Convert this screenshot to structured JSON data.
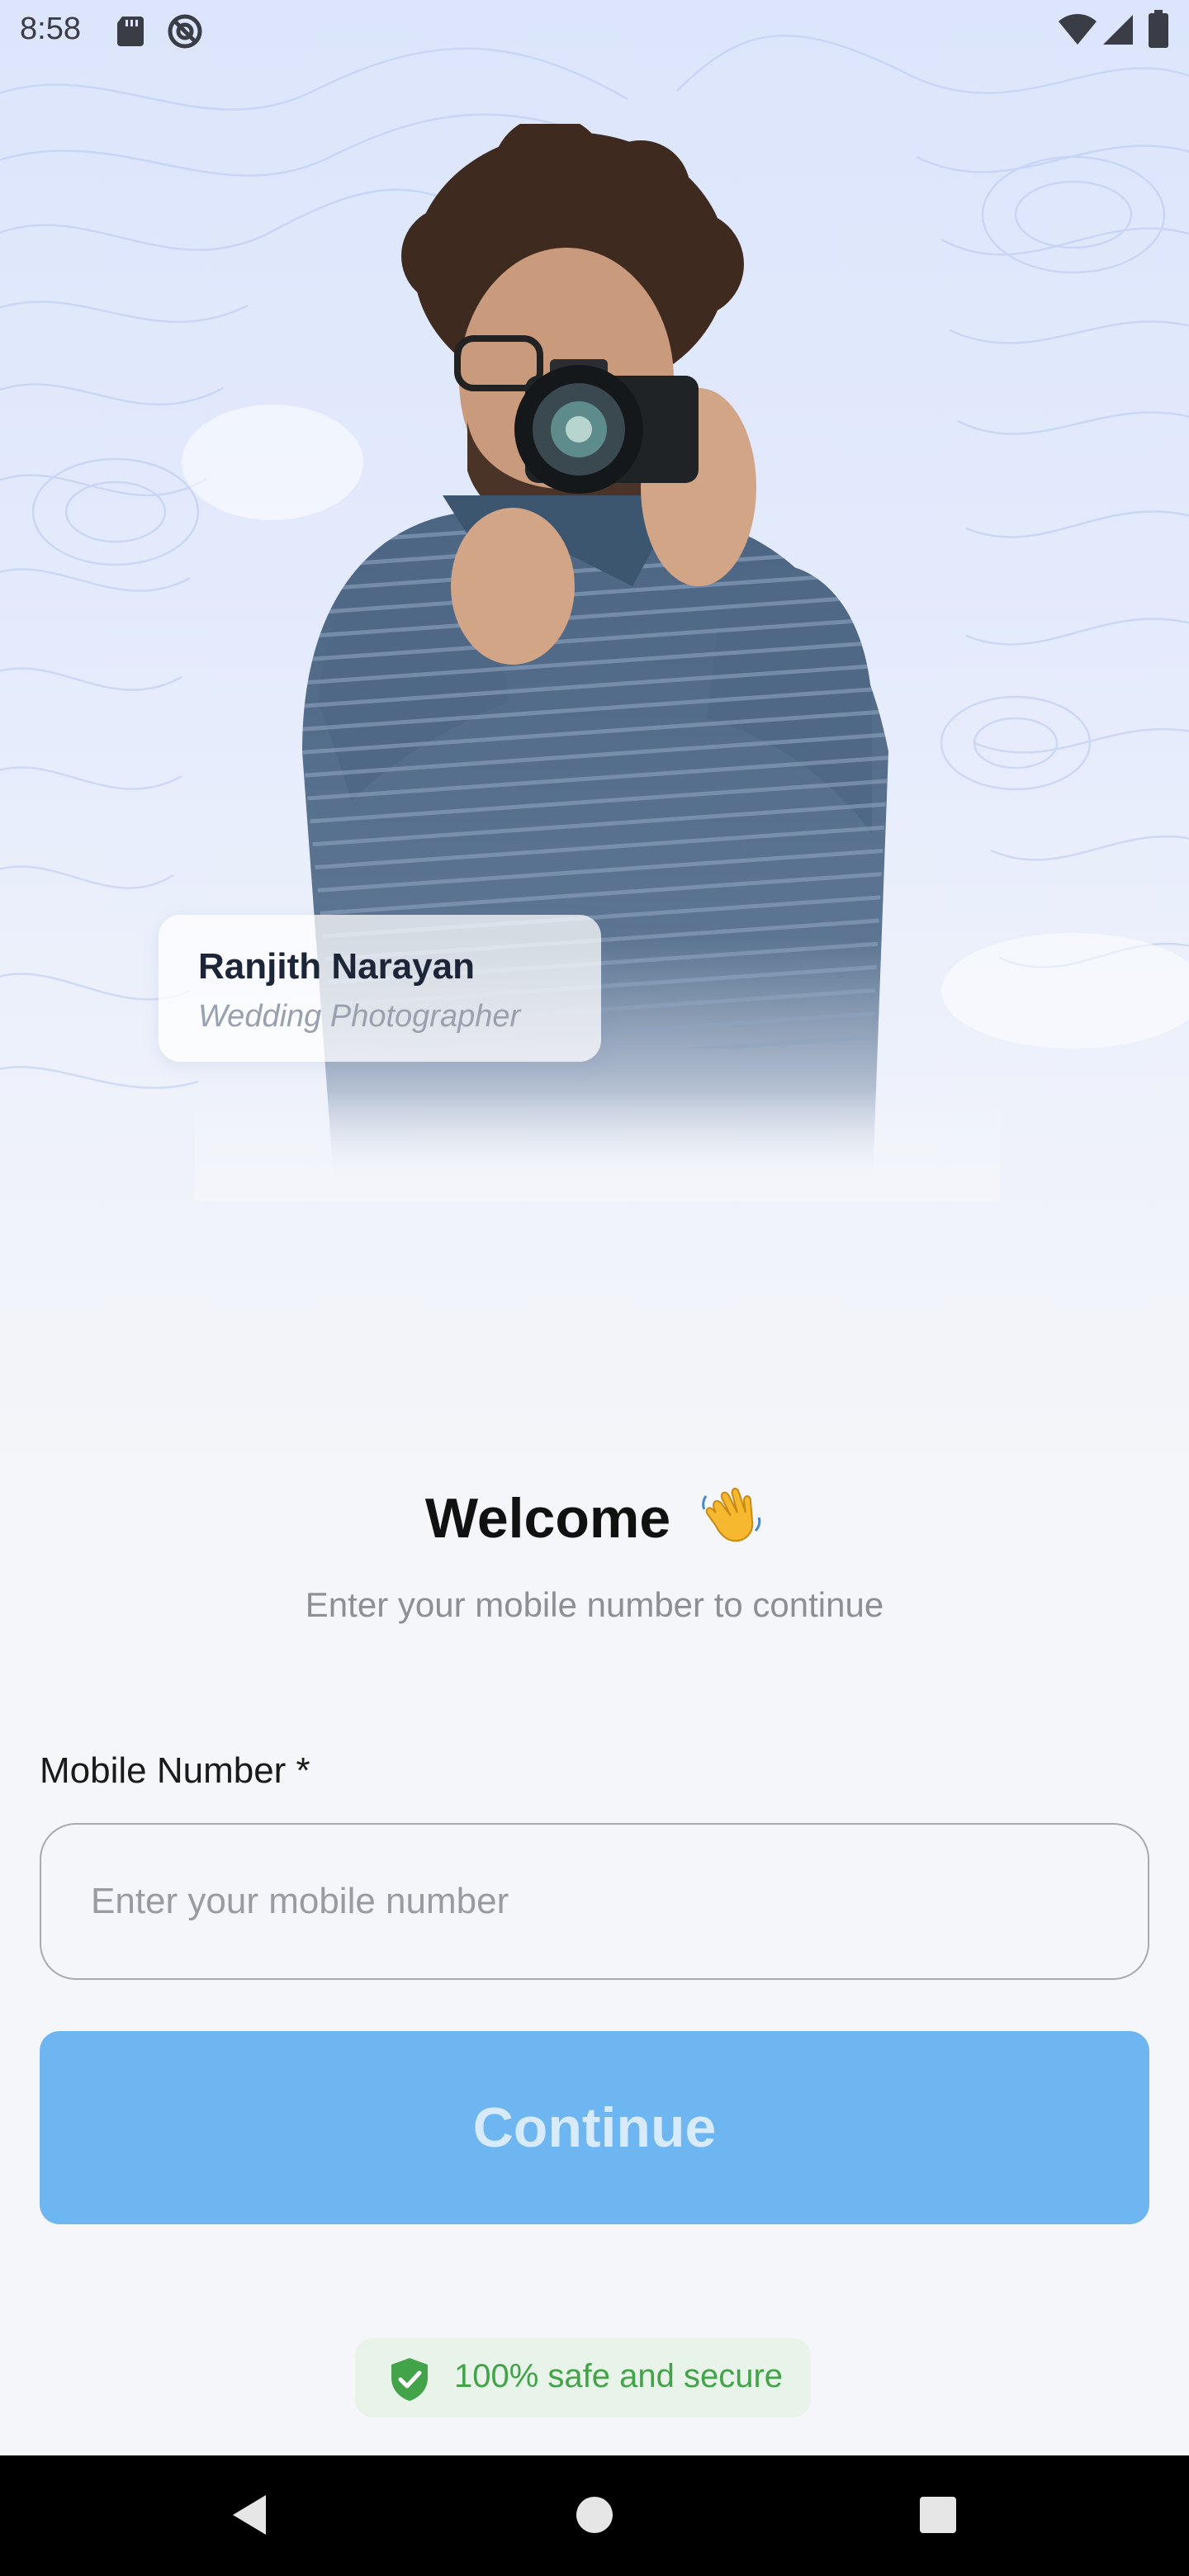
{
  "status_bar": {
    "time": "8:58"
  },
  "hero": {
    "person_name": "Ranjith Narayan",
    "person_role": "Wedding Photographer"
  },
  "welcome": {
    "title": "Welcome",
    "title_emoji": "waving-hand-icon",
    "subtitle": "Enter your mobile number to continue"
  },
  "form": {
    "mobile_label": "Mobile Number *",
    "mobile_placeholder": "Enter your mobile number",
    "mobile_value": "",
    "continue_label": "Continue"
  },
  "secure": {
    "text": "100% safe and secure",
    "icon": "shield-check-icon"
  },
  "nav": {
    "back_icon": "back-triangle-icon",
    "home_icon": "home-circle-icon",
    "recents_icon": "recents-square-icon"
  },
  "colors": {
    "accent_button": "#6eb6f2",
    "secure_green": "#43a349",
    "background": "#f5f6f9"
  }
}
